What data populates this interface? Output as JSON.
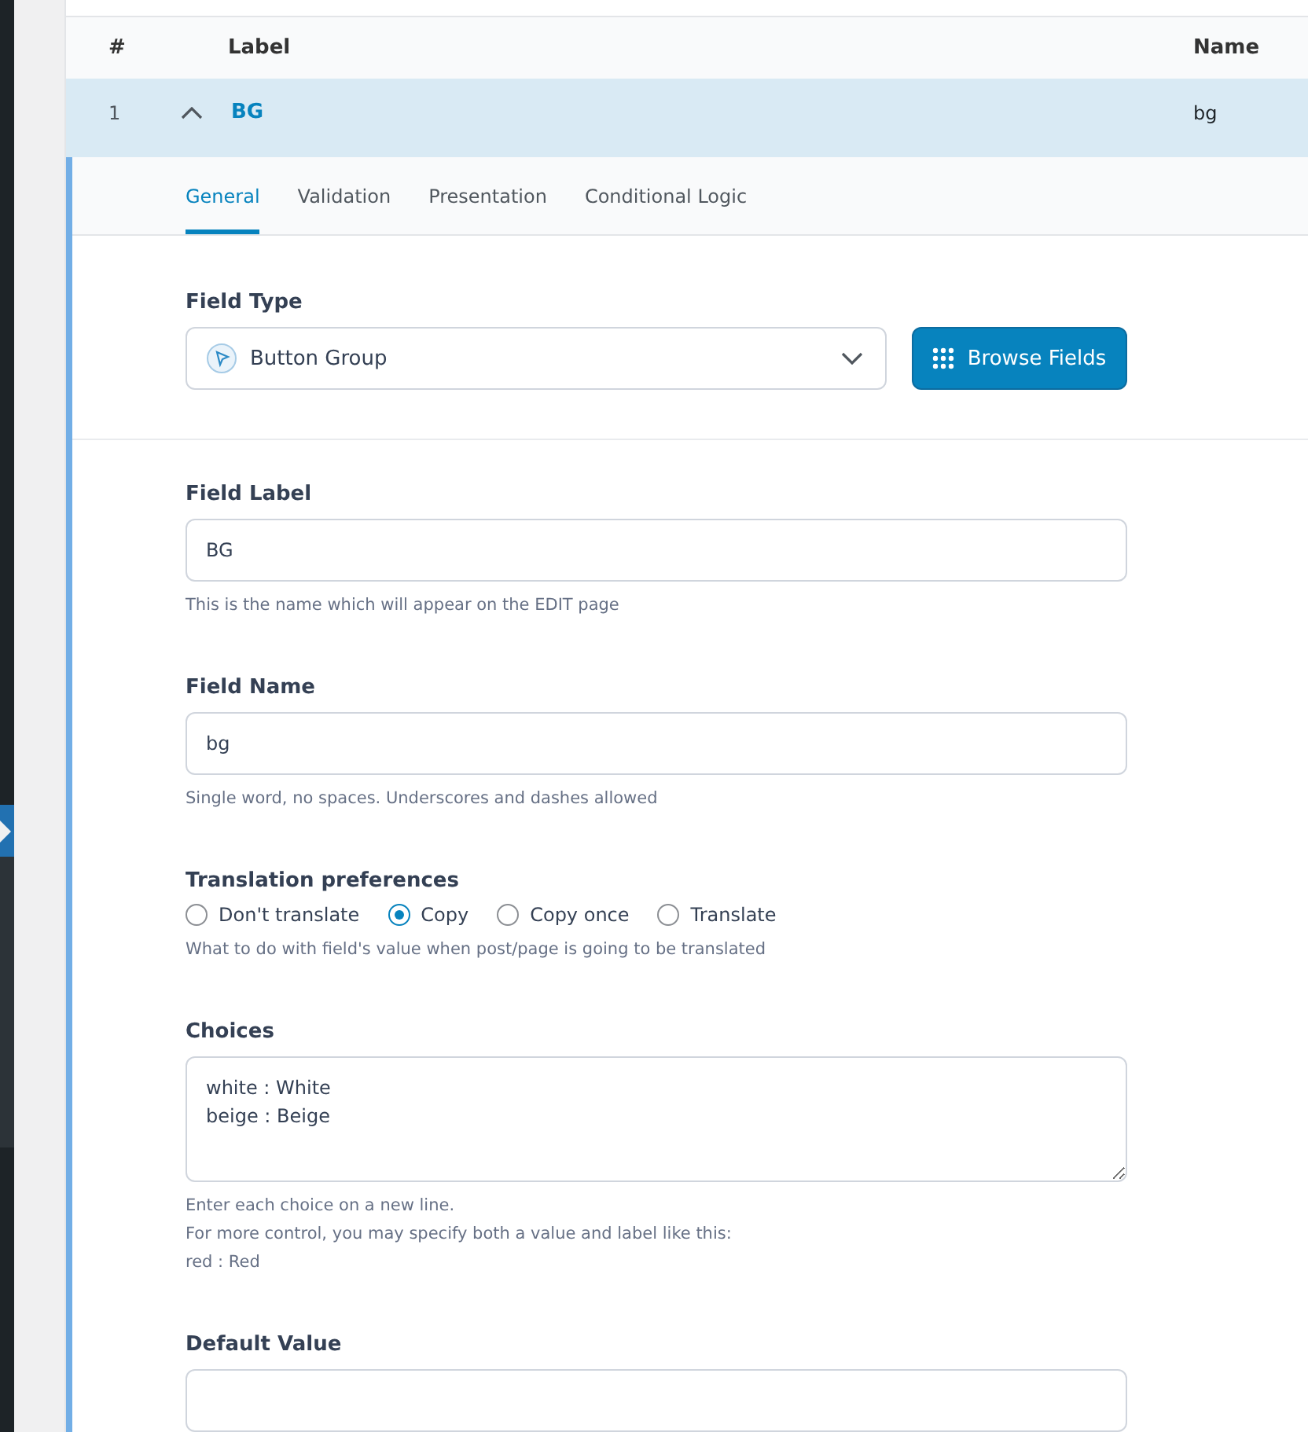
{
  "table": {
    "columns": [
      {
        "label": "#"
      },
      {
        "label": "Label"
      },
      {
        "label": "Name"
      }
    ],
    "rows": [
      {
        "number": "1",
        "label": "BG",
        "name": "bg",
        "expanded": true
      }
    ]
  },
  "tabs": [
    {
      "label": "General",
      "selected": true
    },
    {
      "label": "Validation",
      "selected": false
    },
    {
      "label": "Presentation",
      "selected": false
    },
    {
      "label": "Conditional Logic",
      "selected": false
    }
  ],
  "field_type": {
    "label": "Field Type",
    "value": "Button Group",
    "button": "Browse Fields"
  },
  "fields": [
    {
      "kind": "text",
      "label": "Field Label",
      "value": "BG",
      "help": [
        "This is the name which will appear on the EDIT page"
      ]
    },
    {
      "kind": "text",
      "label": "Field Name",
      "value": "bg",
      "help": [
        "Single word, no spaces. Underscores and dashes allowed"
      ]
    },
    {
      "kind": "radio",
      "label": "Translation preferences",
      "options": [
        {
          "label": "Don't translate",
          "selected": false
        },
        {
          "label": "Copy",
          "selected": true
        },
        {
          "label": "Copy once",
          "selected": false
        },
        {
          "label": "Translate",
          "selected": false
        }
      ],
      "help": [
        "What to do with field's value when post/page is going to be translated"
      ]
    },
    {
      "kind": "textarea",
      "label": "Choices",
      "value": "white : White\nbeige : Beige",
      "help": [
        "Enter each choice on a new line.",
        "For more control, you may specify both a value and label like this:",
        "red : Red"
      ]
    },
    {
      "kind": "text",
      "label": "Default Value"
    }
  ]
}
